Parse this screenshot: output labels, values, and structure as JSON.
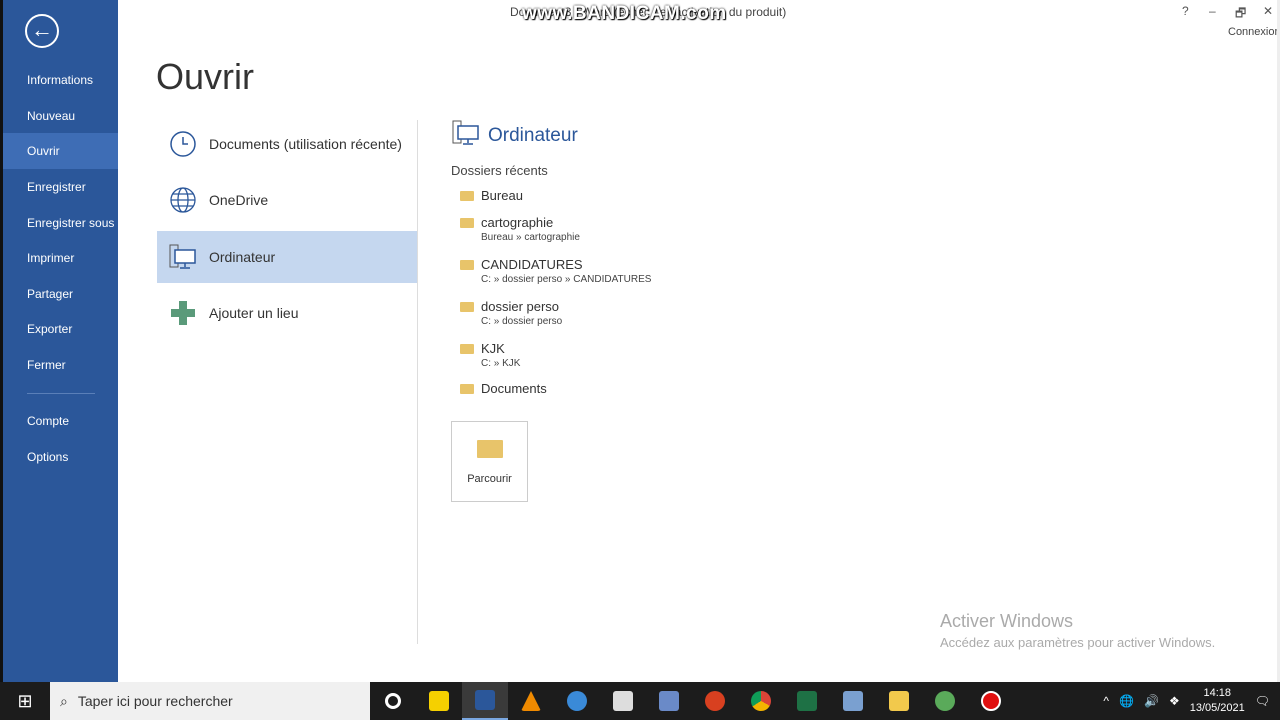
{
  "window": {
    "title": "Document3 - Word (échec de l'activation du produit)",
    "watermark": "www.BANDICAM.com",
    "help": "?",
    "minimize": "–",
    "restore": "🗗",
    "close": "✕",
    "account": "Connexion"
  },
  "sidebar": {
    "items": [
      {
        "label": "Informations"
      },
      {
        "label": "Nouveau"
      },
      {
        "label": "Ouvrir",
        "active": true
      },
      {
        "label": "Enregistrer"
      },
      {
        "label": "Enregistrer sous"
      },
      {
        "label": "Imprimer"
      },
      {
        "label": "Partager"
      },
      {
        "label": "Exporter"
      },
      {
        "label": "Fermer"
      },
      {
        "label": "Compte"
      },
      {
        "label": "Options"
      }
    ]
  },
  "page_title": "Ouvrir",
  "locations": [
    {
      "label": "Documents (utilisation récente)",
      "icon": "clock-icon"
    },
    {
      "label": "OneDrive",
      "icon": "globe-icon"
    },
    {
      "label": "Ordinateur",
      "icon": "computer-icon",
      "selected": true
    },
    {
      "label": "Ajouter un lieu",
      "icon": "plus-icon"
    }
  ],
  "right": {
    "heading": "Ordinateur",
    "recent_label": "Dossiers récents",
    "folders": [
      {
        "name": "Bureau",
        "path": ""
      },
      {
        "name": "cartographie",
        "path": "Bureau » cartographie"
      },
      {
        "name": "CANDIDATURES",
        "path": "C: » dossier perso » CANDIDATURES"
      },
      {
        "name": "dossier perso",
        "path": "C: » dossier perso"
      },
      {
        "name": "KJK",
        "path": "C: » KJK"
      },
      {
        "name": "Documents",
        "path": ""
      }
    ],
    "browse": "Parcourir"
  },
  "activation": {
    "title": "Activer Windows",
    "text": "Accédez aux paramètres pour activer Windows."
  },
  "taskbar": {
    "search_placeholder": "Taper ici pour rechercher",
    "time": "14:18",
    "date": "13/05/2021"
  },
  "colors": {
    "accent": "#2b579a",
    "selected": "#c5d7ef"
  }
}
